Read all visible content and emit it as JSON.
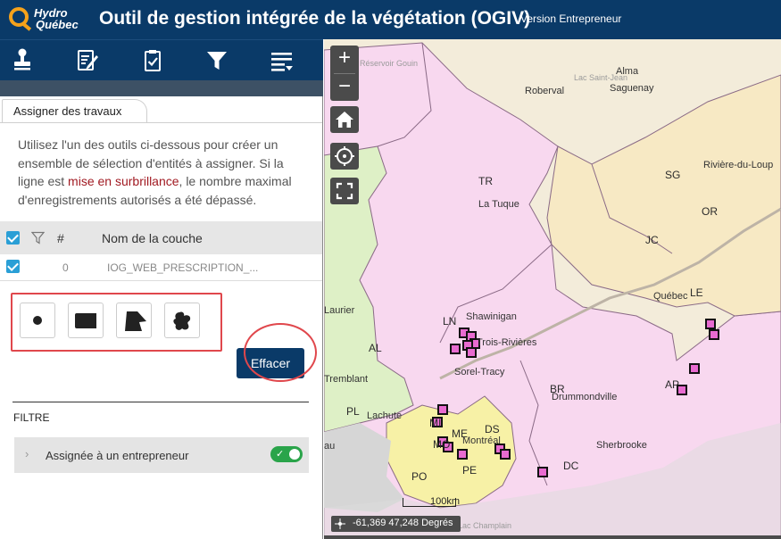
{
  "header": {
    "logo_line1": "Hydro",
    "logo_line2": "Québec",
    "title": "Outil de gestion intégrée de la végétation (OGIV)",
    "version": "Version Entrepreneur",
    "bg_color": "#0a3a68",
    "logo_color": "#f5a21b"
  },
  "toolbar": {
    "items": [
      {
        "icon": "stamp-icon"
      },
      {
        "icon": "edit-document-icon"
      },
      {
        "icon": "clipboard-check-icon"
      },
      {
        "icon": "filter-icon"
      },
      {
        "icon": "list-menu-icon"
      }
    ]
  },
  "panel": {
    "tab_label": "Assigner des travaux",
    "instructions_part1": "Utilisez l'un des outils ci-dessous pour créer un ensemble de sélection d'entités à assigner. Si la ligne est ",
    "instructions_highlight": "mise en surbrillance",
    "instructions_part2": ", le nombre maximal d'enregistrements autorisés a été dépassé.",
    "table": {
      "headers": {
        "count": "#",
        "layer_name": "Nom de la couche"
      },
      "rows": [
        {
          "checked": true,
          "count": "0",
          "layer_name": "IOG_WEB_PRESCRIPTION_..."
        }
      ]
    },
    "selection_tools": [
      {
        "name": "point-tool",
        "icon": "point-icon"
      },
      {
        "name": "rectangle-tool",
        "icon": "rectangle-icon"
      },
      {
        "name": "polygon-tool",
        "icon": "polygon-icon"
      },
      {
        "name": "freehand-tool",
        "icon": "freehand-icon"
      }
    ],
    "clear_button": "Effacer",
    "filter_heading": "FILTRE",
    "filter_item": {
      "label": "Assignée à un entrepreneur",
      "enabled": true
    },
    "highlight_color": "#a11a22",
    "annotation_color": "#e0474c"
  },
  "map": {
    "zoom_in": "+",
    "zoom_out": "−",
    "coordinates": "-61,369 47,248 Degrés",
    "scale": "100km",
    "cities": [
      {
        "name": "Alma"
      },
      {
        "name": "Roberval"
      },
      {
        "name": "Saguenay"
      },
      {
        "name": "La Tuque"
      },
      {
        "name": "Rivière-du-Loup"
      },
      {
        "name": "Québec"
      },
      {
        "name": "Shawinigan"
      },
      {
        "name": "Trois-Rivières"
      },
      {
        "name": "Sorel-Tracy"
      },
      {
        "name": "Drummondville"
      },
      {
        "name": "Lachute"
      },
      {
        "name": "Montréal"
      },
      {
        "name": "Sherbrooke"
      },
      {
        "name": "Laurier"
      },
      {
        "name": "Tremblant"
      },
      {
        "name": "au"
      }
    ],
    "regions": [
      "TR",
      "SG",
      "OR",
      "JC",
      "LE",
      "LN",
      "AL",
      "BR",
      "AP",
      "PL",
      "MI",
      "ME",
      "DS",
      "MO",
      "PE",
      "PO",
      "DC"
    ],
    "pale_labels": [
      "Lac Saint-Jean",
      "Réservoir Gouin",
      "Lac Champlain"
    ],
    "colors": {
      "pink_region": "#f8d8ef",
      "green_region": "#def0c6",
      "yellow_region": "#f7f1a6",
      "beige_region": "#f7e9c4",
      "marker": "#e86bd0"
    }
  }
}
